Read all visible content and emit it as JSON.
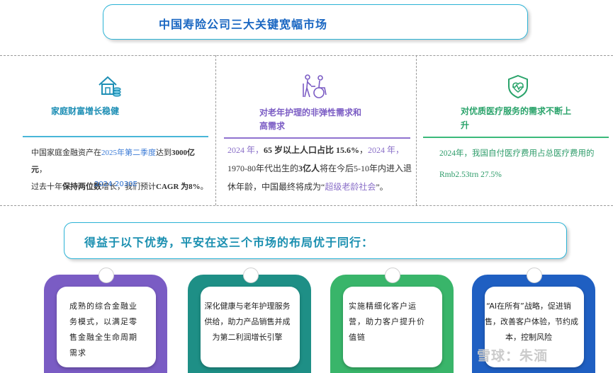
{
  "title": "中国寿险公司三大关键宽幅市场",
  "markets": [
    {
      "title": "家庭财富增长稳健",
      "icon": "house-coins-icon",
      "lines": [
        [
          {
            "t": "中国家庭金融资产在",
            "s": ""
          },
          {
            "t": "2025年第二季度",
            "s": "blue"
          },
          {
            "t": "达到",
            "s": ""
          },
          {
            "t": "3000亿元",
            "s": "bold"
          },
          {
            "t": "，",
            "s": ""
          }
        ],
        [
          {
            "t": "过去十年",
            "s": ""
          },
          {
            "t": "保持两位数",
            "s": "bold"
          },
          {
            "t": "增长，我们预计",
            "s": ""
          },
          {
            "t": "CAGR 为8%",
            "s": "bold"
          },
          {
            "t": "。",
            "s": ""
          }
        ]
      ],
      "footnote": "2024-2030E"
    },
    {
      "title_line1": "对老年护理的非弹性需求和",
      "title_line2": "高需求",
      "icon": "elderly-care-icon",
      "lines": [
        [
          {
            "t": "2024 年，",
            "s": "purple"
          },
          {
            "t": "65 岁以上人口占比 15.6%",
            "s": "bold"
          },
          {
            "t": "，",
            "s": ""
          },
          {
            "t": "2024 年，",
            "s": "purple"
          }
        ],
        [
          {
            "t": "1970-80年代出生的",
            "s": ""
          },
          {
            "t": "3亿人",
            "s": "bold"
          },
          {
            "t": "将在今后5-10年内进入退",
            "s": ""
          }
        ],
        [
          {
            "t": "休年龄，中国最终将成为“",
            "s": ""
          },
          {
            "t": "超级老龄社会",
            "s": "purple"
          },
          {
            "t": "”。",
            "s": ""
          }
        ]
      ]
    },
    {
      "title_line1": "对优质医疗服务的需求不断上",
      "title_line2": "升",
      "icon": "health-shield-icon",
      "lines": [
        "2024年，我国自付医疗费用占总医疗费用的",
        "Rmb2.53trn 27.5%"
      ]
    }
  ],
  "benefit_title": "得益于以下优势，平安在这三个市场的布局优于同行：",
  "cards": [
    {
      "lines": [
        "成熟的综合金融业",
        "务模式，以满足零",
        "售金融全生命周期",
        "需求"
      ],
      "color": "#7a5cc4"
    },
    {
      "lines": [
        "深化健康与老年护理服务",
        "供给，助力产品销售并成",
        "为第二利润增长引擎"
      ],
      "color": "#1e8f86"
    },
    {
      "lines": [
        "实施精细化客户运",
        "营，助力客户提升价",
        "值链"
      ],
      "color": "#39b56a"
    },
    {
      "lines": [
        "“AI在所有”战略，促进销",
        "售，改善客户体验，节约成",
        "本，控制风险"
      ],
      "color": "#1f5fc2"
    }
  ],
  "watermark": "雪球：朱湎",
  "colors": {
    "accent": "#2bb3d6",
    "col1": "#1e8fb5",
    "col2": "#7b5cc4",
    "col3": "#29a36a"
  }
}
